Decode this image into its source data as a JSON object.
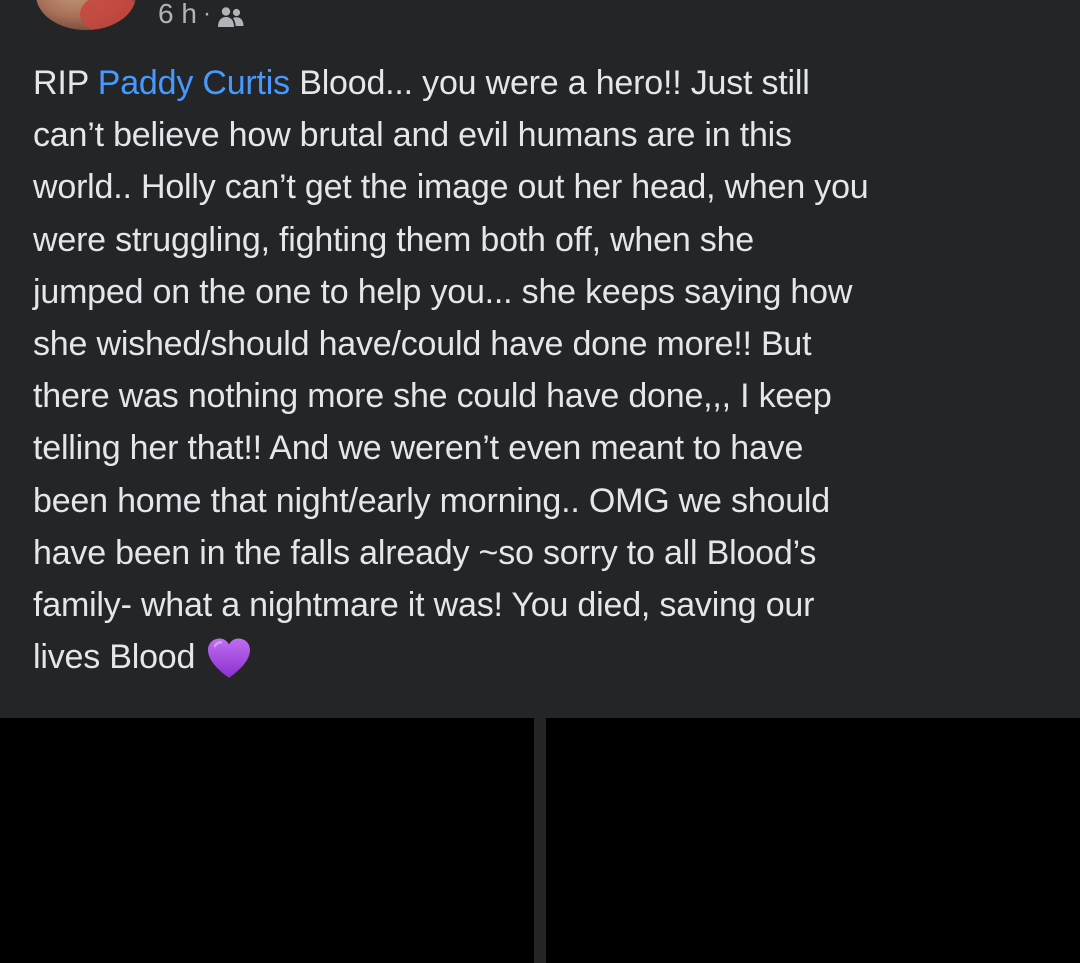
{
  "post": {
    "timestamp": "6 h",
    "separator": "·",
    "audience_icon": "friends-icon",
    "text_lines": [
      {
        "prefix": "RIP ",
        "mention": "Paddy Curtis",
        "suffix": " Blood... you were a hero!! Just still"
      },
      "can’t believe how brutal and evil humans are in this",
      "world.. Holly can’t get the image out her head, when you",
      "were struggling, fighting them both off, when she",
      "jumped on the one to help you... she keeps saying how",
      "she wished/should have/could have done more!! But",
      "there was nothing more she could have done,,, I keep",
      "telling her that!! And we weren’t even meant to have",
      "been home that night/early morning.. OMG we should",
      "have been in the falls already ~so sorry to all Blood’s",
      "family- what a nightmare it was! You died, saving our",
      "lives Blood"
    ],
    "end_icon": "purple-heart-icon"
  },
  "colors": {
    "card_background": "#242526",
    "text": "#e4e6eb",
    "mention": "#4599ff",
    "meta": "#b0b3b8",
    "heart": "#a64bdc"
  }
}
